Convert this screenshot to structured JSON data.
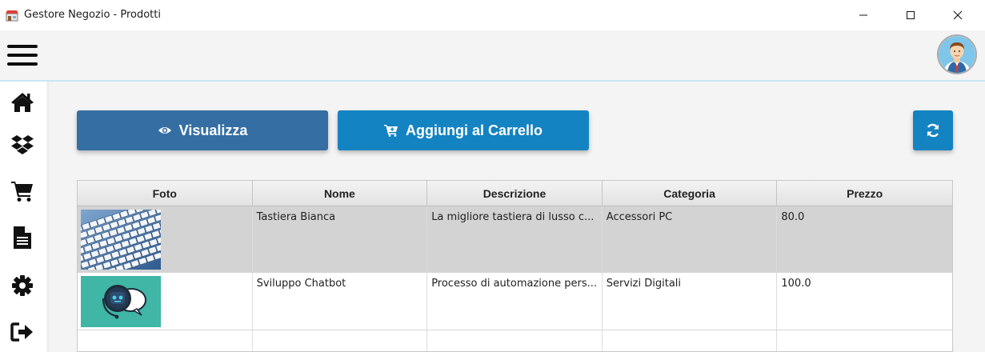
{
  "window": {
    "title": "Gestore Negozio - Prodotti",
    "app_icon": "shop-icon",
    "controls": [
      "minimize-icon",
      "maximize-icon",
      "close-icon"
    ]
  },
  "header": {
    "menu_icon": "hamburger-menu-icon",
    "avatar": "user-avatar"
  },
  "sidebar": {
    "items": [
      {
        "icon": "home-icon"
      },
      {
        "icon": "dropbox-icon"
      },
      {
        "icon": "cart-icon"
      },
      {
        "icon": "document-icon"
      },
      {
        "icon": "gear-icon"
      },
      {
        "icon": "logout-icon"
      }
    ]
  },
  "toolbar": {
    "view_label": "Visualizza",
    "view_icon": "eye-icon",
    "add_cart_label": "Aggiungi al Carrello",
    "add_cart_icon": "cart-plus-icon",
    "refresh_icon": "refresh-icon"
  },
  "table": {
    "columns": [
      "Foto",
      "Nome",
      "Descrizione",
      "Categoria",
      "Prezzo"
    ],
    "rows": [
      {
        "foto": "keyboard-image",
        "nome": "Tastiera Bianca",
        "descrizione": "La migliore tastiera di lusso c...",
        "categoria": "Accessori PC",
        "prezzo": "80.0",
        "selected": true
      },
      {
        "foto": "chatbot-image",
        "nome": "Sviluppo Chatbot",
        "descrizione": "Processo di automazione pers...",
        "categoria": "Servizi Digitali",
        "prezzo": "100.0",
        "selected": false
      }
    ]
  },
  "colors": {
    "view_button": "#356ea3",
    "cart_button": "#1483c1",
    "selected_row": "#d3d3d3"
  }
}
